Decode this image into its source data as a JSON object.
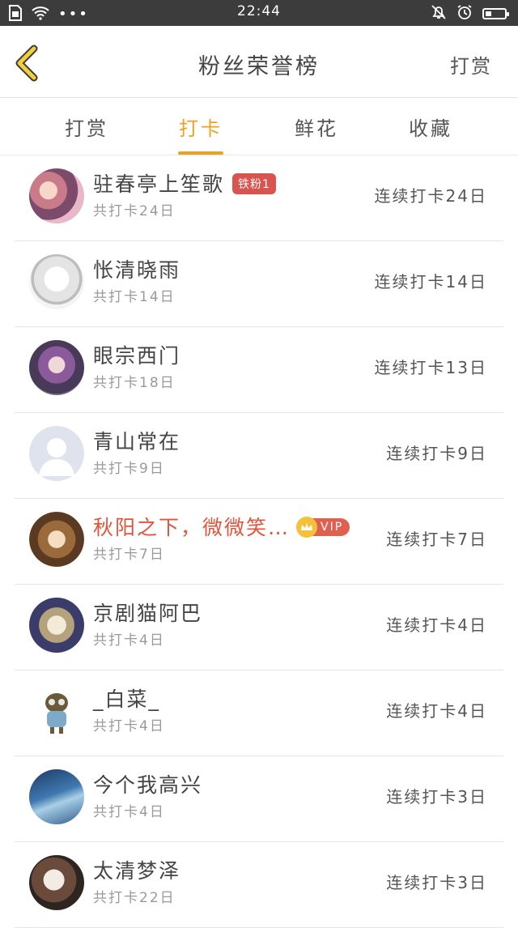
{
  "status_bar": {
    "time": "22:44",
    "icons_left": [
      "sim-icon",
      "wifi-icon",
      "more-dots-icon"
    ],
    "icons_right": [
      "mute-bell-icon",
      "alarm-icon",
      "battery-icon"
    ]
  },
  "header": {
    "title": "粉丝荣誉榜",
    "action": "打赏",
    "back_icon": "chevron-left-icon"
  },
  "tabs": [
    {
      "label": "打赏",
      "active": false
    },
    {
      "label": "打卡",
      "active": true
    },
    {
      "label": "鲜花",
      "active": false
    },
    {
      "label": "收藏",
      "active": false
    }
  ],
  "colors": {
    "accent": "#f0a01e",
    "vip_name": "#e2553b",
    "fan_badge": "#d9534f"
  },
  "rows": [
    {
      "name": "驻春亭上笙歌",
      "badge": "铁粉1",
      "total": "共打卡24日",
      "streak": "连续打卡24日"
    },
    {
      "name": "怅清晓雨",
      "total": "共打卡14日",
      "streak": "连续打卡14日"
    },
    {
      "name": "眼宗西门",
      "total": "共打卡18日",
      "streak": "连续打卡13日"
    },
    {
      "name": "青山常在",
      "total": "共打卡9日",
      "streak": "连续打卡9日"
    },
    {
      "name": "秋阳之下，微微笑…",
      "vip": "VIP",
      "total": "共打卡7日",
      "streak": "连续打卡7日"
    },
    {
      "name": "京剧猫阿巴",
      "total": "共打卡4日",
      "streak": "连续打卡4日"
    },
    {
      "name": "_白菜_",
      "total": "共打卡4日",
      "streak": "连续打卡4日"
    },
    {
      "name": "今个我高兴",
      "total": "共打卡4日",
      "streak": "连续打卡3日"
    },
    {
      "name": "太清梦泽",
      "total": "共打卡22日",
      "streak": "连续打卡3日"
    }
  ]
}
